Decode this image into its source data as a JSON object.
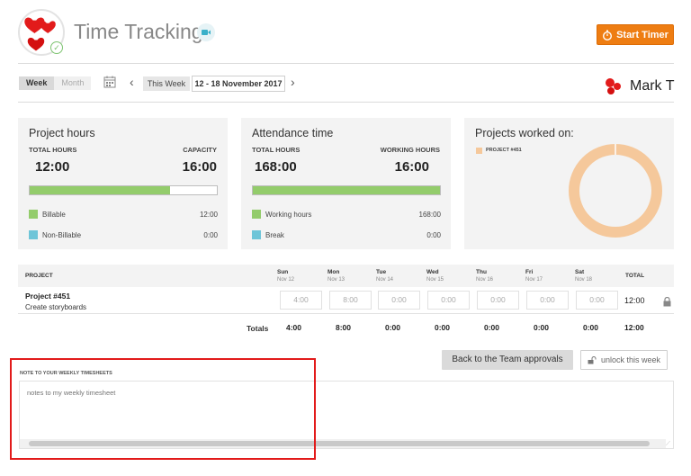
{
  "header": {
    "title": "Time Tracking",
    "start_timer_label": "Start Timer",
    "video_icon": "video-camera-icon",
    "colors": {
      "accent": "#ee7d12",
      "logo_red": "#e21b1b",
      "check_green": "#7cc36f"
    }
  },
  "toolbar": {
    "view_week": "Week",
    "view_month": "Month",
    "this_week_label": "This Week",
    "date_range": "12 - 18 November 2017",
    "user_name": "Mark T"
  },
  "cards": {
    "project_hours": {
      "title": "Project hours",
      "total_label": "TOTAL HOURS",
      "total_value": "12:00",
      "capacity_label": "CAPACITY",
      "capacity_value": "16:00",
      "progress_fraction": 0.75,
      "legend": [
        {
          "label": "Billable",
          "value": "12:00",
          "color": "#93cc6b"
        },
        {
          "label": "Non-Billable",
          "value": "0:00",
          "color": "#6ec5d8"
        }
      ]
    },
    "attendance": {
      "title": "Attendance time",
      "total_label": "TOTAL HOURS",
      "total_value": "168:00",
      "working_label": "WORKING HOURS",
      "working_value": "16:00",
      "progress_fraction": 1.0,
      "legend": [
        {
          "label": "Working hours",
          "value": "168:00",
          "color": "#93cc6b"
        },
        {
          "label": "Break",
          "value": "0:00",
          "color": "#6ec5d8"
        }
      ]
    },
    "projects_worked": {
      "title": "Projects worked on:",
      "legend": [
        {
          "label": "PROJECT #451",
          "color": "#f5c89b"
        }
      ],
      "chart_data": {
        "type": "pie",
        "labels": [
          "PROJECT #451"
        ],
        "values": [
          100
        ]
      }
    }
  },
  "table": {
    "col_project": "PROJECT",
    "col_total": "TOTAL",
    "days": [
      {
        "name": "Sun",
        "date": "Nov 12"
      },
      {
        "name": "Mon",
        "date": "Nov 13"
      },
      {
        "name": "Tue",
        "date": "Nov 14"
      },
      {
        "name": "Wed",
        "date": "Nov 15"
      },
      {
        "name": "Thu",
        "date": "Nov 16"
      },
      {
        "name": "Fri",
        "date": "Nov 17"
      },
      {
        "name": "Sat",
        "date": "Nov 18"
      }
    ],
    "rows": [
      {
        "project": "Project #451",
        "task": "Create storyboards",
        "values": [
          "4:00",
          "8:00",
          "0:00",
          "0:00",
          "0:00",
          "0:00",
          "0:00"
        ],
        "total": "12:00"
      }
    ],
    "totals_label": "Totals",
    "totals": [
      "4:00",
      "8:00",
      "0:00",
      "0:00",
      "0:00",
      "0:00",
      "0:00"
    ],
    "grand_total": "12:00"
  },
  "actions": {
    "back_label": "Back to the Team approvals",
    "unlock_label": "unlock this week"
  },
  "notes": {
    "label": "NOTE TO YOUR WEEKLY TIMESHEETS",
    "placeholder": "notes to my weekly timesheet"
  }
}
